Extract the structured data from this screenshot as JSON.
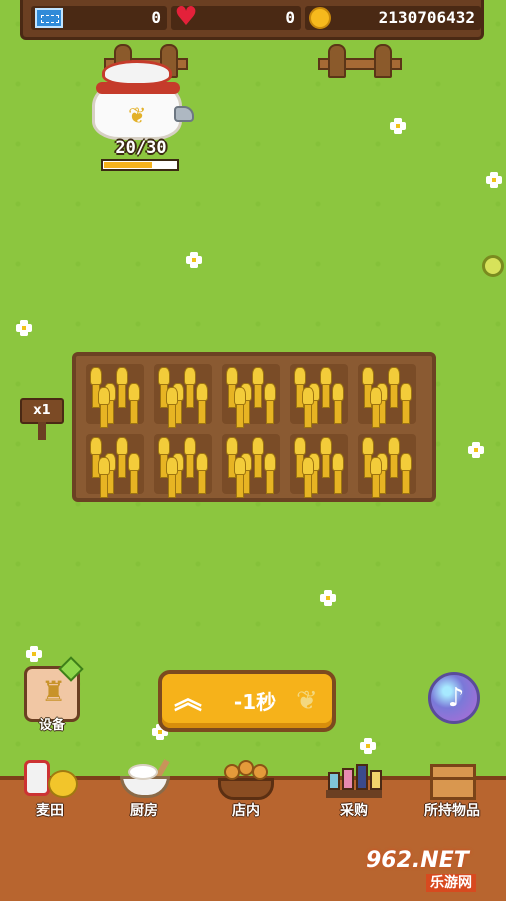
{
  "status_bar": {
    "tickets": "0",
    "hearts": "0",
    "coins": "2130706432"
  },
  "flour_sack": {
    "count_label": "20/30",
    "progress_fraction": 0.667
  },
  "field": {
    "multiplier_label": "x1"
  },
  "equipment": {
    "label": "设备"
  },
  "speed_button": {
    "label": "-1秒"
  },
  "bottom_nav": {
    "items": [
      {
        "label": "麦田",
        "icon": "wheat-field-icon"
      },
      {
        "label": "厨房",
        "icon": "kitchen-icon"
      },
      {
        "label": "店内",
        "icon": "store-icon"
      },
      {
        "label": "采购",
        "icon": "purchase-icon"
      },
      {
        "label": "所持物品",
        "icon": "inventory-icon"
      }
    ]
  },
  "watermark": {
    "logo": "962.NET",
    "sub": "乐游网"
  },
  "colors": {
    "grass": "#8cc63f",
    "wood": "#6b3f22",
    "gold": "#f6b21a"
  }
}
